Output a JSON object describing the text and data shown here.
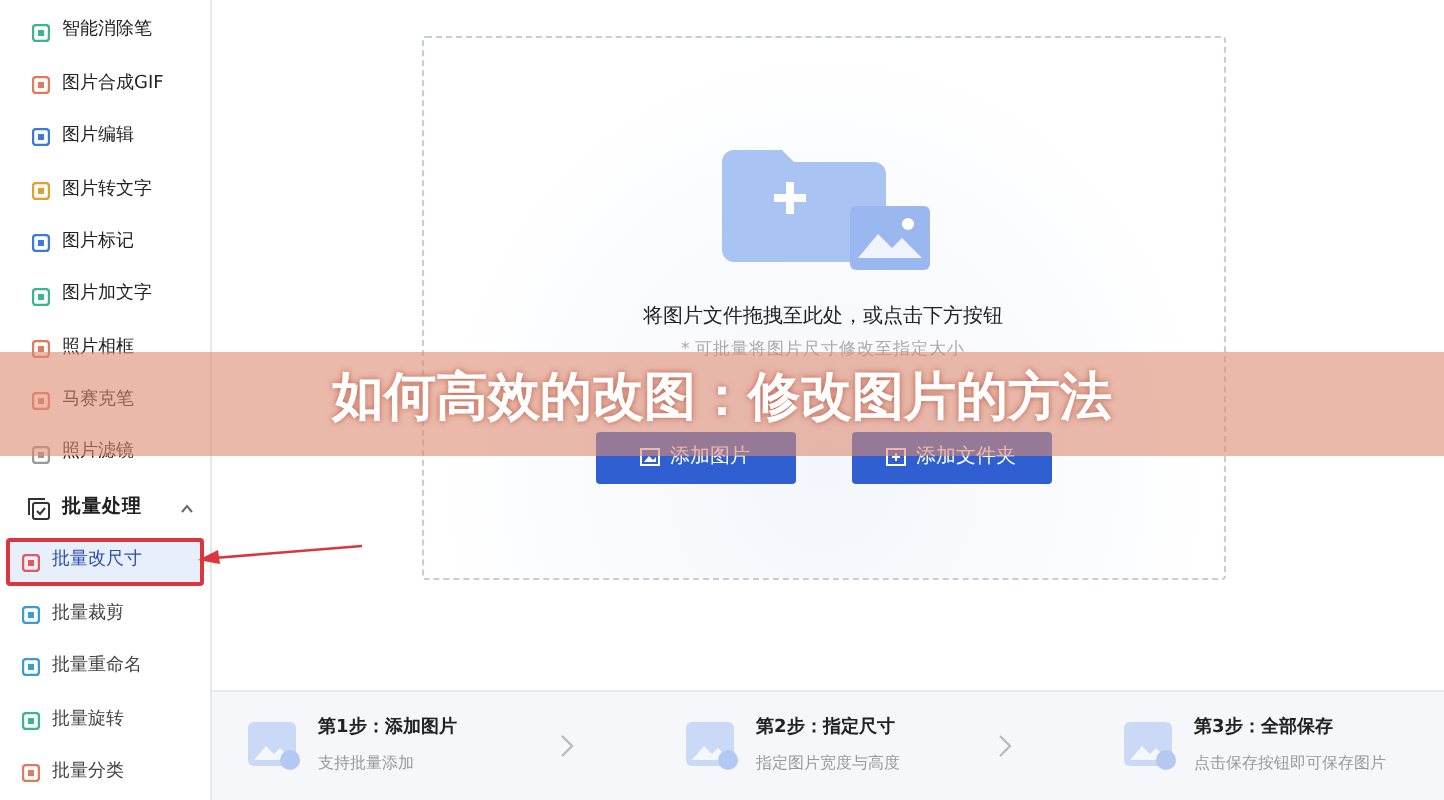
{
  "sidebar": {
    "tools": [
      {
        "label": "智能消除笔"
      },
      {
        "label": "图片合成GIF"
      },
      {
        "label": "图片编辑"
      },
      {
        "label": "图片转文字"
      },
      {
        "label": "图片标记"
      },
      {
        "label": "图片加文字"
      },
      {
        "label": "照片相框"
      },
      {
        "label": "马赛克笔"
      },
      {
        "label": "照片滤镜"
      }
    ],
    "group": {
      "label": "批量处理",
      "expanded": true,
      "children": [
        {
          "label": "批量改尺寸",
          "selected": true
        },
        {
          "label": "批量裁剪",
          "selected": false
        },
        {
          "label": "批量重命名",
          "selected": false
        },
        {
          "label": "批量旋转",
          "selected": false
        },
        {
          "label": "批量分类",
          "selected": false
        }
      ]
    }
  },
  "dropzone": {
    "title": "将图片文件拖拽至此处，或点击下方按钮",
    "hint": "* 可批量将图片尺寸修改至指定大小",
    "buttons": [
      "添加图片",
      "添加文件夹"
    ]
  },
  "steps": [
    {
      "title": "第1步：添加图片",
      "subtitle": "支持批量添加"
    },
    {
      "title": "第2步：指定尺寸",
      "subtitle": "指定图片宽度与高度"
    },
    {
      "title": "第3步：全部保存",
      "subtitle": "点击保存按钮即可保存图片"
    }
  ],
  "banner": {
    "title": "如何高效的改图：修改图片的方法"
  }
}
